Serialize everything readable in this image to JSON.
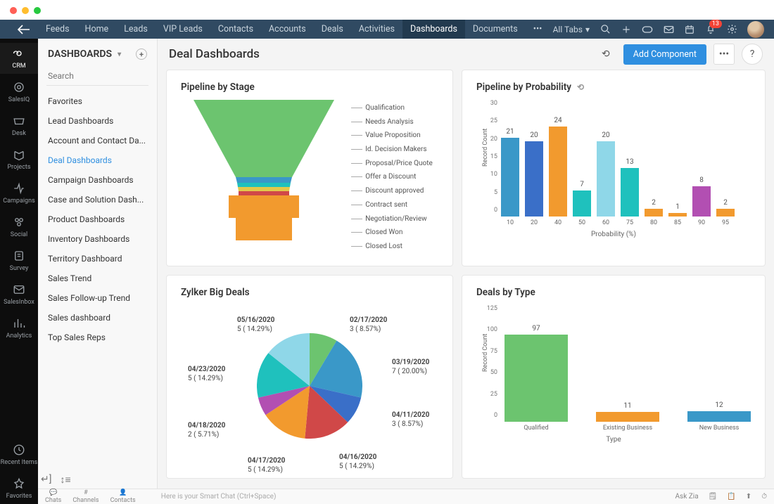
{
  "mac": true,
  "topnav": {
    "tabs": [
      "Feeds",
      "Home",
      "Leads",
      "VIP Leads",
      "Contacts",
      "Accounts",
      "Deals",
      "Activities",
      "Dashboards",
      "Documents"
    ],
    "active": 8,
    "all_tabs_label": "All Tabs",
    "bell_badge": "13"
  },
  "rail": {
    "items": [
      "CRM",
      "SalesIQ",
      "Desk",
      "Projects",
      "Campaigns",
      "Social",
      "Survey",
      "SalesInbox",
      "Analytics"
    ],
    "active": 0,
    "bottom": [
      "Recent Items",
      "Favorites"
    ]
  },
  "panel": {
    "title": "DASHBOARDS",
    "search_placeholder": "Search",
    "items": [
      "Favorites",
      "Lead Dashboards",
      "Account and Contact Da...",
      "Deal Dashboards",
      "Campaign Dashboards",
      "Case and Solution Dash...",
      "Product Dashboards",
      "Inventory Dashboards",
      "Territory Dashboard",
      "Sales Trend",
      "Sales Follow-up Trend",
      "Sales dashboard",
      "Top Sales Reps"
    ],
    "active": 3
  },
  "main": {
    "title": "Deal Dashboards",
    "add_button": "Add Component"
  },
  "chart_data": [
    {
      "id": "pipeline_by_stage",
      "type": "funnel",
      "title": "Pipeline by Stage",
      "stages": [
        {
          "name": "Qualification",
          "color": "#6cc46f"
        },
        {
          "name": "Needs Analysis",
          "color": "#6cc46f"
        },
        {
          "name": "Value Proposition",
          "color": "#6cc46f"
        },
        {
          "name": "Id. Decision Makers",
          "color": "#6cc46f"
        },
        {
          "name": "Proposal/Price Quote",
          "color": "#3a98c8"
        },
        {
          "name": "Offer a Discount",
          "color": "#1fc1bd"
        },
        {
          "name": "Discount approved",
          "color": "#e2c94b"
        },
        {
          "name": "Contract sent",
          "color": "#d04848"
        },
        {
          "name": "Negotiation/Review",
          "color": "#f29a2e"
        },
        {
          "name": "Closed Won",
          "color": "#f29a2e"
        },
        {
          "name": "Closed Lost",
          "color": "#f29a2e"
        }
      ]
    },
    {
      "id": "pipeline_by_probability",
      "type": "bar",
      "title": "Pipeline by Probability",
      "xlabel": "Probability (%)",
      "ylabel": "Record Count",
      "ylim": [
        0,
        30
      ],
      "categories": [
        "10",
        "20",
        "40",
        "50",
        "60",
        "75",
        "80",
        "85",
        "90",
        "95"
      ],
      "values": [
        21,
        20,
        24,
        7,
        20,
        13,
        2,
        1,
        8,
        2
      ],
      "colors": [
        "#3a98c8",
        "#3a6fc8",
        "#f29a2e",
        "#1fc1bd",
        "#8fd7e8",
        "#1fc1bd",
        "#f29a2e",
        "#f29a2e",
        "#b24fb2",
        "#f29a2e"
      ]
    },
    {
      "id": "zylker_big_deals",
      "type": "pie",
      "title": "Zylker Big Deals",
      "series": [
        {
          "name": "02/17/2020",
          "value": 3,
          "pct": 8.57,
          "color": "#6cc46f"
        },
        {
          "name": "03/19/2020",
          "value": 7,
          "pct": 20.0,
          "color": "#3a98c8"
        },
        {
          "name": "04/11/2020",
          "value": 3,
          "pct": 8.57,
          "color": "#3a6fc8"
        },
        {
          "name": "04/16/2020",
          "value": 5,
          "pct": 14.29,
          "color": "#d04848"
        },
        {
          "name": "04/17/2020",
          "value": 5,
          "pct": 14.29,
          "color": "#f29a2e"
        },
        {
          "name": "04/18/2020",
          "value": 2,
          "pct": 5.71,
          "color": "#b24fb2"
        },
        {
          "name": "04/23/2020",
          "value": 5,
          "pct": 14.29,
          "color": "#1fc1bd"
        },
        {
          "name": "05/16/2020",
          "value": 5,
          "pct": 14.29,
          "color": "#8fd7e8"
        }
      ]
    },
    {
      "id": "deals_by_type",
      "type": "bar",
      "title": "Deals by Type",
      "xlabel": "Type",
      "ylabel": "Record Count",
      "ylim": [
        0,
        125
      ],
      "categories": [
        "Qualified",
        "Existing Business",
        "New Business"
      ],
      "values": [
        97,
        11,
        12
      ],
      "colors": [
        "#6cc46f",
        "#f29a2e",
        "#3a98c8"
      ]
    }
  ],
  "bottom": {
    "tabs": [
      "Chats",
      "Channels",
      "Contacts"
    ],
    "smart_chat": "Here is your Smart Chat (Ctrl+Space)",
    "ask_zia": "Ask Zia"
  }
}
